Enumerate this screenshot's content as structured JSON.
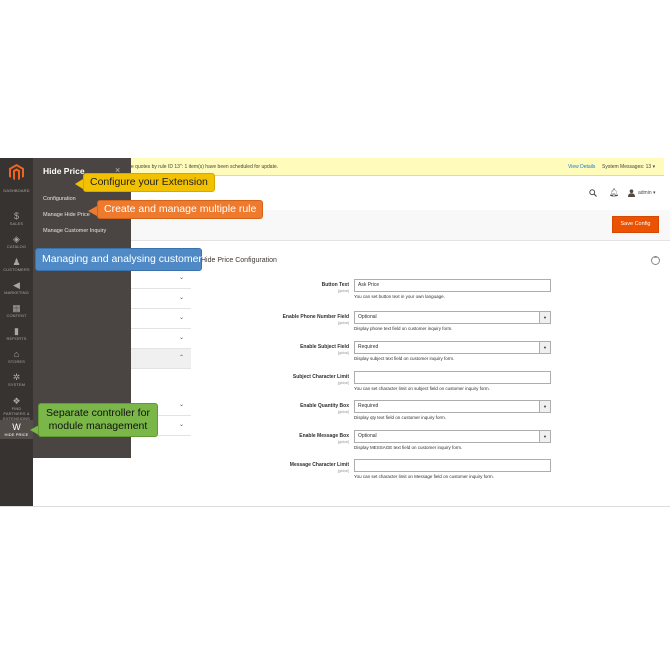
{
  "sidebar": {
    "items": [
      {
        "icon": "dashboard-icon",
        "glyph": "◔",
        "label": "DASHBOARD"
      },
      {
        "icon": "dollar-icon",
        "glyph": "$",
        "label": "SALES"
      },
      {
        "icon": "box-icon",
        "glyph": "◈",
        "label": "CATALOG"
      },
      {
        "icon": "person-icon",
        "glyph": "♟",
        "label": "CUSTOMERS"
      },
      {
        "icon": "megaphone-icon",
        "glyph": "◀",
        "label": "MARKETING"
      },
      {
        "icon": "layout-icon",
        "glyph": "▦",
        "label": "CONTENT"
      },
      {
        "icon": "bar-chart-icon",
        "glyph": "▮",
        "label": "REPORTS"
      },
      {
        "icon": "store-icon",
        "glyph": "⌂",
        "label": "STORES"
      },
      {
        "icon": "gear-icon",
        "glyph": "✲",
        "label": "SYSTEM"
      },
      {
        "icon": "cubes-icon",
        "glyph": "❖",
        "label": "FIND PARTNERS & EXTENSIONS"
      },
      {
        "icon": "hide-price-icon",
        "glyph": "W",
        "label": "HIDE PRICE"
      }
    ]
  },
  "flyout": {
    "title": "Hide Price",
    "close": "×",
    "links": [
      "Configuration",
      "Manage Hide Price",
      "Manage Customer Inquiry"
    ]
  },
  "notice": {
    "message": "e quotes by rule ID 13\": 1 item(s) have been scheduled for update.",
    "view_details": "View Details",
    "system_messages": "System Messages: 13"
  },
  "header": {
    "admin_label": "admin ▾"
  },
  "actions": {
    "save_label": "Save Config"
  },
  "section": {
    "title": "Hide Price Configuration",
    "toggle": "⌃",
    "fields": [
      {
        "label": "Button Text",
        "scope": "[global]",
        "type": "text",
        "value": "Ask Price",
        "note": "You can set button text in your own language."
      },
      {
        "label": "Enable Phone Number Field",
        "scope": "[global]",
        "type": "select",
        "value": "Optional",
        "note": "Display phone text field on customer inquiry form."
      },
      {
        "label": "Enable Subject Field",
        "scope": "[global]",
        "type": "select",
        "value": "Required",
        "note": "Display subject text field on customer inquiry form."
      },
      {
        "label": "Subject Character Limit",
        "scope": "[global]",
        "type": "text",
        "value": "",
        "note": "You can set character limit on subject field on customer inquiry form."
      },
      {
        "label": "Enable Quantity Box",
        "scope": "[global]",
        "type": "select",
        "value": "Required",
        "note": "Display qty text field on customer inquiry form."
      },
      {
        "label": "Enable Message Box",
        "scope": "[global]",
        "type": "select",
        "value": "Optional",
        "note": "Display MESSAGE text field on customer inquiry form."
      },
      {
        "label": "Message Character Limit",
        "scope": "[global]",
        "type": "text",
        "value": "",
        "note": "You can set character limit on Message field on customer inquiry form."
      }
    ]
  },
  "callouts": {
    "configure": "Configure your Extension",
    "create": "Create and manage multiple rule",
    "managing": "Managing and analysing customer",
    "separate": "Separate controller for module management"
  },
  "colors": {
    "accent": "#eb5202",
    "sidebar": "#373330",
    "flyout": "#4a4542",
    "notice": "#fffbbb"
  }
}
